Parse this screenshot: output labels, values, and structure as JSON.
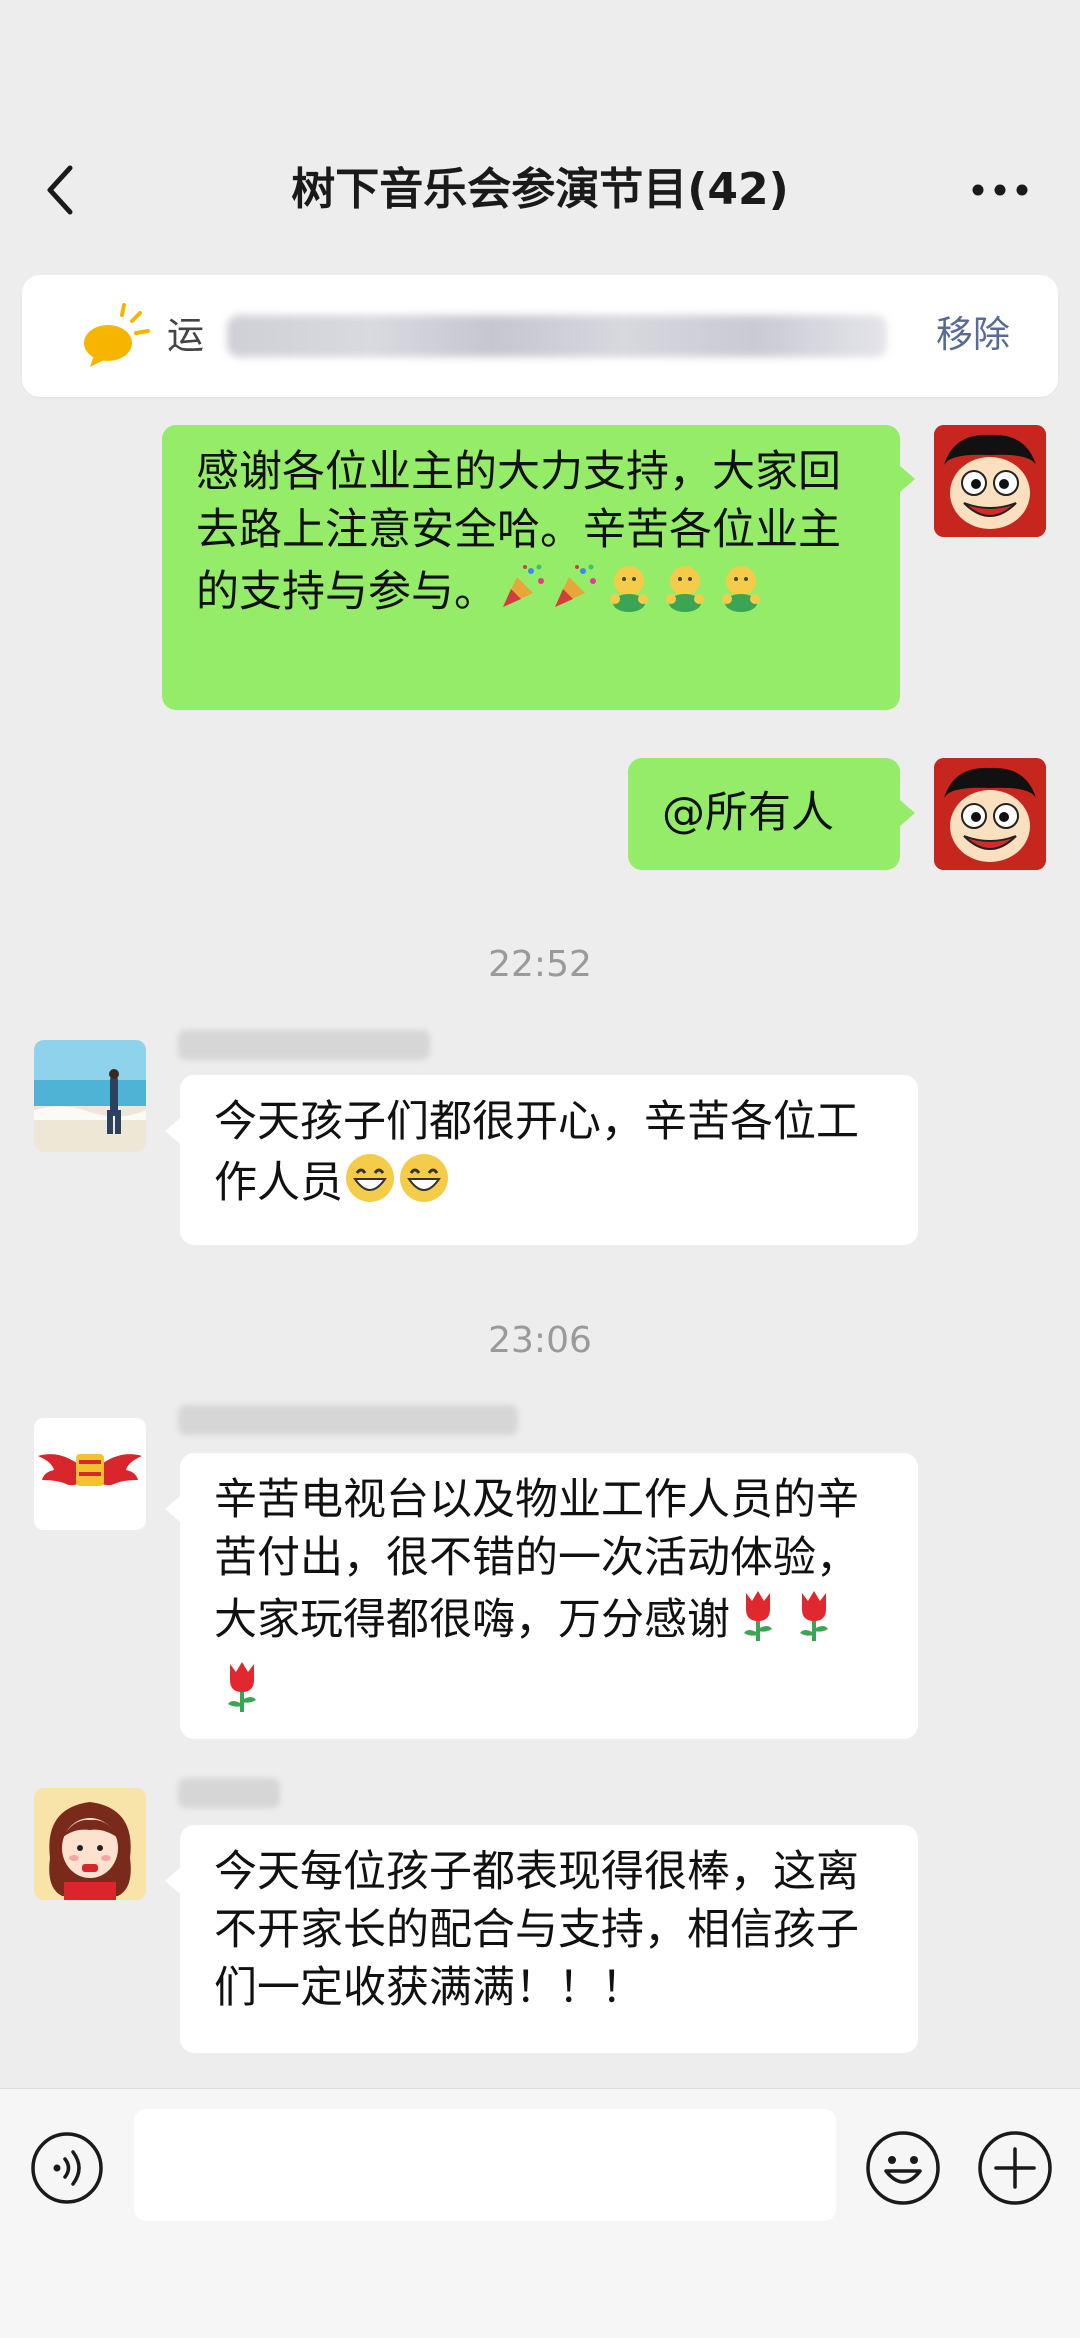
{
  "header": {
    "title": "树下音乐会参演节目(42)"
  },
  "notice": {
    "visible_prefix": "运",
    "remove_label": "移除"
  },
  "messages": [
    {
      "side": "right",
      "text": "感谢各位业主的大力支持，大家回去路上注意安全哈。辛苦各位业主的支持与参与。",
      "emojis": [
        "party-popper",
        "party-popper",
        "hug-face",
        "hug-face",
        "hug-face"
      ]
    },
    {
      "side": "right",
      "text": "@所有人"
    },
    {
      "type": "time",
      "text": "22:52"
    },
    {
      "side": "left",
      "avatar": "beach-avatar",
      "text": "今天孩子们都很开心，辛苦各位工作人员",
      "emojis": [
        "grin-face",
        "grin-face"
      ]
    },
    {
      "type": "time",
      "text": "23:06"
    },
    {
      "side": "left",
      "avatar": "wings-logo-avatar",
      "text": "辛苦电视台以及物业工作人员的辛苦付出，很不错的一次活动体验，大家玩得都很嗨，万分感谢",
      "emojis": [
        "tulip",
        "tulip",
        "tulip"
      ]
    },
    {
      "side": "left",
      "avatar": "girl-avatar",
      "text": "今天每位孩子都表现得很棒，这离不开家长的配合与支持，相信孩子们一定收获满满！！！"
    }
  ],
  "colors": {
    "bg": "#ededed",
    "my_bubble": "#95ec69",
    "other_bubble": "#ffffff",
    "link_blue": "#576b95"
  },
  "icons": [
    "back-arrow-icon",
    "more-dots-icon",
    "notice-bulb-icon",
    "voice-icon",
    "emoji-icon",
    "plus-icon"
  ]
}
